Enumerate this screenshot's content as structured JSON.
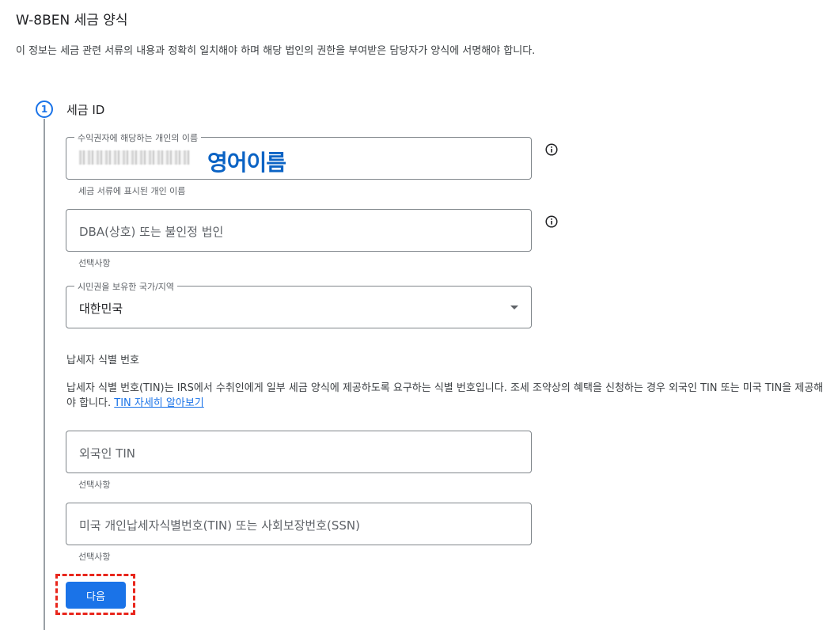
{
  "header": {
    "title": "W-8BEN 세금 양식",
    "subtitle": "이 정보는 세금 관련 서류의 내용과 정확히 일치해야 하며 해당 법인의 권한을 부여받은 담당자가 양식에 서명해야 합니다."
  },
  "step": {
    "number": "1",
    "title": "세금 ID"
  },
  "fields": {
    "beneficiary_name": {
      "label": "수익권자에 해당하는 개인의 이름",
      "overlay_text": "영어이름",
      "helper": "세금 서류에 표시된 개인 이름"
    },
    "dba": {
      "placeholder": "DBA(상호) 또는 불인정 법인",
      "helper": "선택사항"
    },
    "country": {
      "label": "시민권을 보유한 국가/지역",
      "value": "대한민국"
    },
    "foreign_tin": {
      "placeholder": "외국인 TIN",
      "helper": "선택사항"
    },
    "us_tin": {
      "placeholder": "미국 개인납세자식별번호(TIN) 또는 사회보장번호(SSN)",
      "helper": "선택사항"
    }
  },
  "tin_section": {
    "heading": "납세자 식별 번호",
    "paragraph": "납세자 식별 번호(TIN)는 IRS에서 수취인에게 일부 세금 양식에 제공하도록 요구하는 식별 번호입니다. 조세 조약상의 혜택을 신청하는 경우 외국인 TIN 또는 미국 TIN을 제공해야 합니다.",
    "link_text": "TIN 자세히 알아보기"
  },
  "actions": {
    "next_label": "다음"
  },
  "colors": {
    "accent": "#1a73e8",
    "highlight": "#e8261c",
    "overlay_text": "#0b63c4"
  },
  "icons": {
    "info": "info-icon",
    "dropdown": "dropdown-arrow-icon"
  }
}
